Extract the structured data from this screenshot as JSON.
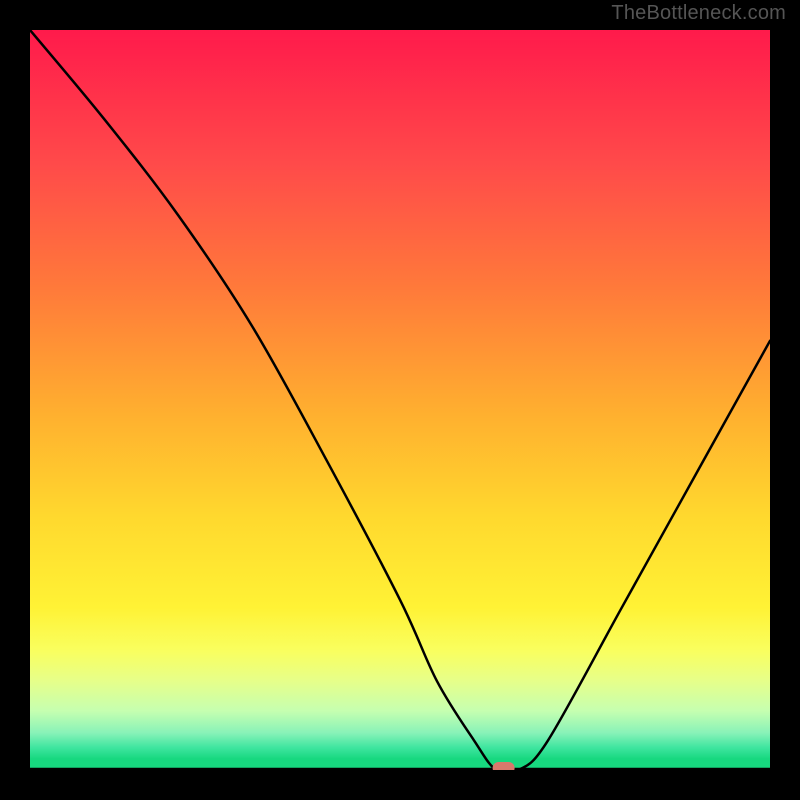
{
  "watermark": "TheBottleneck.com",
  "chart_data": {
    "type": "line",
    "title": "",
    "xlabel": "",
    "ylabel": "",
    "xlim": [
      0,
      100
    ],
    "ylim": [
      0,
      100
    ],
    "x": [
      0,
      10,
      20,
      30,
      40,
      50,
      55,
      60,
      63,
      66,
      70,
      80,
      90,
      100
    ],
    "values": [
      100,
      88,
      75,
      60,
      42,
      23,
      12,
      4,
      0,
      0,
      4,
      22,
      40,
      58
    ],
    "marker": {
      "x": 64,
      "y": 0
    },
    "gradient_stops": [
      {
        "pct": 0,
        "color": "#ff1a4b"
      },
      {
        "pct": 18,
        "color": "#ff4a4a"
      },
      {
        "pct": 35,
        "color": "#ff7a3a"
      },
      {
        "pct": 52,
        "color": "#ffb02f"
      },
      {
        "pct": 66,
        "color": "#ffd92e"
      },
      {
        "pct": 78,
        "color": "#fff235"
      },
      {
        "pct": 84,
        "color": "#f9ff60"
      },
      {
        "pct": 88,
        "color": "#e6ff8a"
      },
      {
        "pct": 92,
        "color": "#c6ffb0"
      },
      {
        "pct": 95,
        "color": "#88f2b8"
      },
      {
        "pct": 97,
        "color": "#3ee59f"
      },
      {
        "pct": 98.5,
        "color": "#17d87f"
      },
      {
        "pct": 100,
        "color": "#17d87f"
      }
    ]
  }
}
